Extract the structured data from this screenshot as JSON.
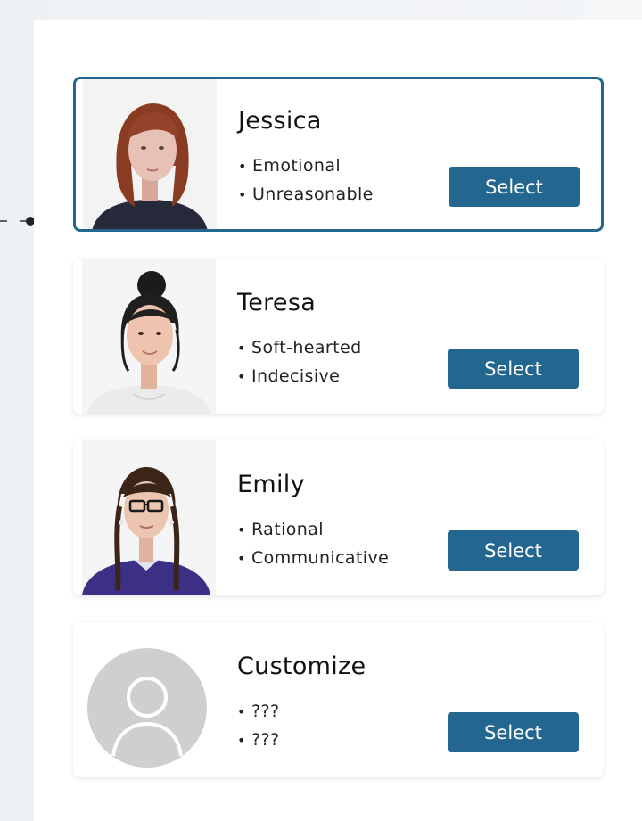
{
  "select_label": "Select",
  "bullet": "•",
  "colors": {
    "accent": "#236690",
    "selected_border": "#23668e",
    "placeholder_gray": "#cfcfcf"
  },
  "personas": [
    {
      "name": "Jessica",
      "traits": [
        "Emotional",
        "Unreasonable"
      ],
      "selected": true,
      "avatar_icon": "woman-red-hair-avatar"
    },
    {
      "name": "Teresa",
      "traits": [
        "Soft-hearted",
        "Indecisive"
      ],
      "selected": false,
      "avatar_icon": "woman-bun-avatar"
    },
    {
      "name": "Emily",
      "traits": [
        "Rational",
        "Communicative"
      ],
      "selected": false,
      "avatar_icon": "woman-glasses-avatar"
    },
    {
      "name": "Customize",
      "traits": [
        "???",
        "???"
      ],
      "selected": false,
      "avatar_icon": "user-placeholder-icon"
    }
  ]
}
